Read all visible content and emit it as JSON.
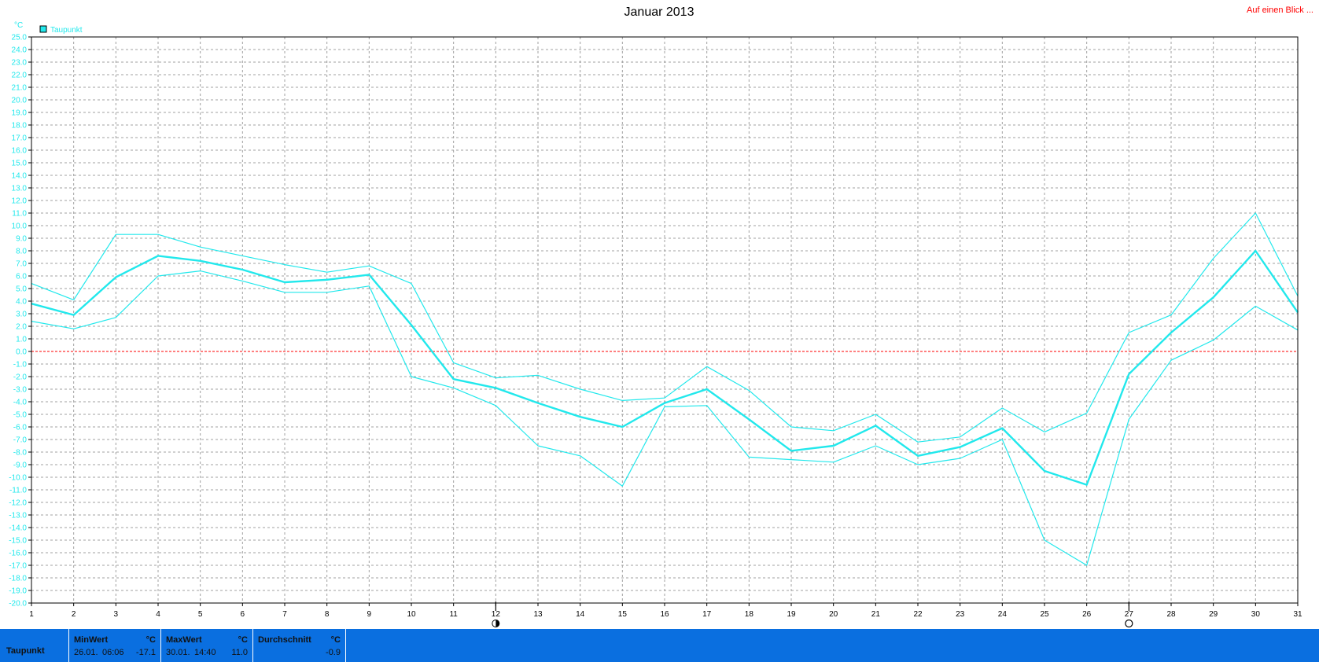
{
  "header": {
    "title": "Januar 2013",
    "link_label": "Auf einen Blick ..."
  },
  "legend": {
    "unit_label": "°C",
    "series_label": "Taupunkt"
  },
  "colors": {
    "series": "#22e8ec",
    "zero_line": "#ff0000",
    "grid": "#a0a0a0",
    "axis": "#000000",
    "title": "#000000",
    "link": "#ff0000",
    "stats_bg": "#0a6fe0"
  },
  "chart_data": {
    "type": "line",
    "title": "Januar 2013",
    "ylabel": "°C",
    "ylim": [
      -20,
      25
    ],
    "y_tick_step": 1,
    "grid": true,
    "legend_position": "top-left",
    "x": [
      1,
      2,
      3,
      4,
      5,
      6,
      7,
      8,
      9,
      10,
      11,
      12,
      13,
      14,
      15,
      16,
      17,
      18,
      19,
      20,
      21,
      22,
      23,
      24,
      25,
      26,
      27,
      28,
      29,
      30,
      31
    ],
    "series": [
      {
        "name": "Taupunkt",
        "role": "max",
        "values": [
          5.4,
          4.1,
          9.3,
          9.3,
          8.3,
          7.6,
          6.9,
          6.3,
          6.8,
          5.4,
          -0.9,
          -2.1,
          -1.9,
          -3.0,
          -3.9,
          -3.7,
          -1.2,
          -3.1,
          -6.0,
          -6.3,
          -5.0,
          -7.2,
          -6.8,
          -4.5,
          -6.4,
          -4.9,
          1.5,
          2.9,
          7.4,
          11.0,
          4.4
        ]
      },
      {
        "name": "Taupunkt",
        "role": "mean",
        "values": [
          3.8,
          2.9,
          5.9,
          7.6,
          7.2,
          6.5,
          5.5,
          5.7,
          6.1,
          2.1,
          -2.2,
          -2.9,
          -4.1,
          -5.2,
          -6.0,
          -4.1,
          -3.0,
          -5.4,
          -7.9,
          -7.5,
          -5.9,
          -8.3,
          -7.6,
          -6.1,
          -9.5,
          -10.6,
          -1.8,
          1.5,
          4.3,
          8.0,
          3.1
        ]
      },
      {
        "name": "Taupunkt",
        "role": "min",
        "values": [
          2.4,
          1.8,
          2.7,
          6.0,
          6.4,
          5.6,
          4.7,
          4.7,
          5.2,
          -2.0,
          -2.9,
          -4.3,
          -7.5,
          -8.3,
          -10.7,
          -4.4,
          -4.3,
          -8.4,
          -8.6,
          -8.8,
          -7.5,
          -9.0,
          -8.5,
          -7.0,
          -15.0,
          -17.0,
          -5.4,
          -0.7,
          0.9,
          3.6,
          1.7
        ]
      }
    ],
    "reference_line": {
      "value": 0,
      "style": "dashed",
      "color": "#ff0000"
    },
    "moon_markers": [
      {
        "day": 12,
        "phase": "half-moon"
      },
      {
        "day": 27,
        "phase": "full-moon"
      }
    ]
  },
  "stats": {
    "series_name": "Taupunkt",
    "min": {
      "label": "MinWert",
      "unit": "°C",
      "date": "26.01.",
      "time": "06:06",
      "value": "-17.1"
    },
    "max": {
      "label": "MaxWert",
      "unit": "°C",
      "date": "30.01.",
      "time": "14:40",
      "value": "11.0"
    },
    "avg": {
      "label": "Durchschnitt",
      "unit": "°C",
      "value": "-0.9"
    }
  }
}
